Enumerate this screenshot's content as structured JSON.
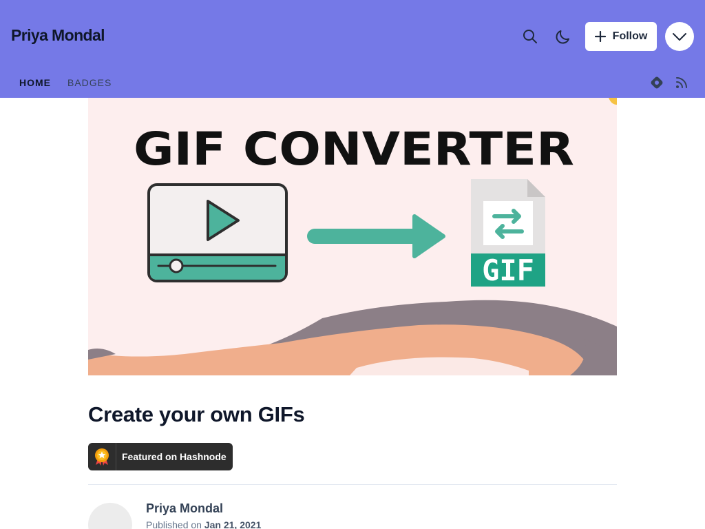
{
  "header": {
    "blog_title": "Priya Mondal",
    "follow_label": "Follow",
    "background": "#7579e7"
  },
  "icons": {
    "search": "search-icon",
    "theme": "moon-icon",
    "follow": "plus-icon",
    "menu": "chevron-down-icon",
    "hashnode": "hashnode-icon",
    "rss": "rss-icon"
  },
  "nav": {
    "items": [
      {
        "label": "HOME",
        "active": true
      },
      {
        "label": "BADGES",
        "active": false
      }
    ]
  },
  "cover": {
    "heading": "GIF CONVERTER",
    "file_label": "GIF"
  },
  "post": {
    "title": "Create your own GIFs",
    "featured_label": "Featured on Hashnode",
    "author": "Priya Mondal",
    "published_prefix": "Published on",
    "published_date": "Jan 21, 2021"
  }
}
